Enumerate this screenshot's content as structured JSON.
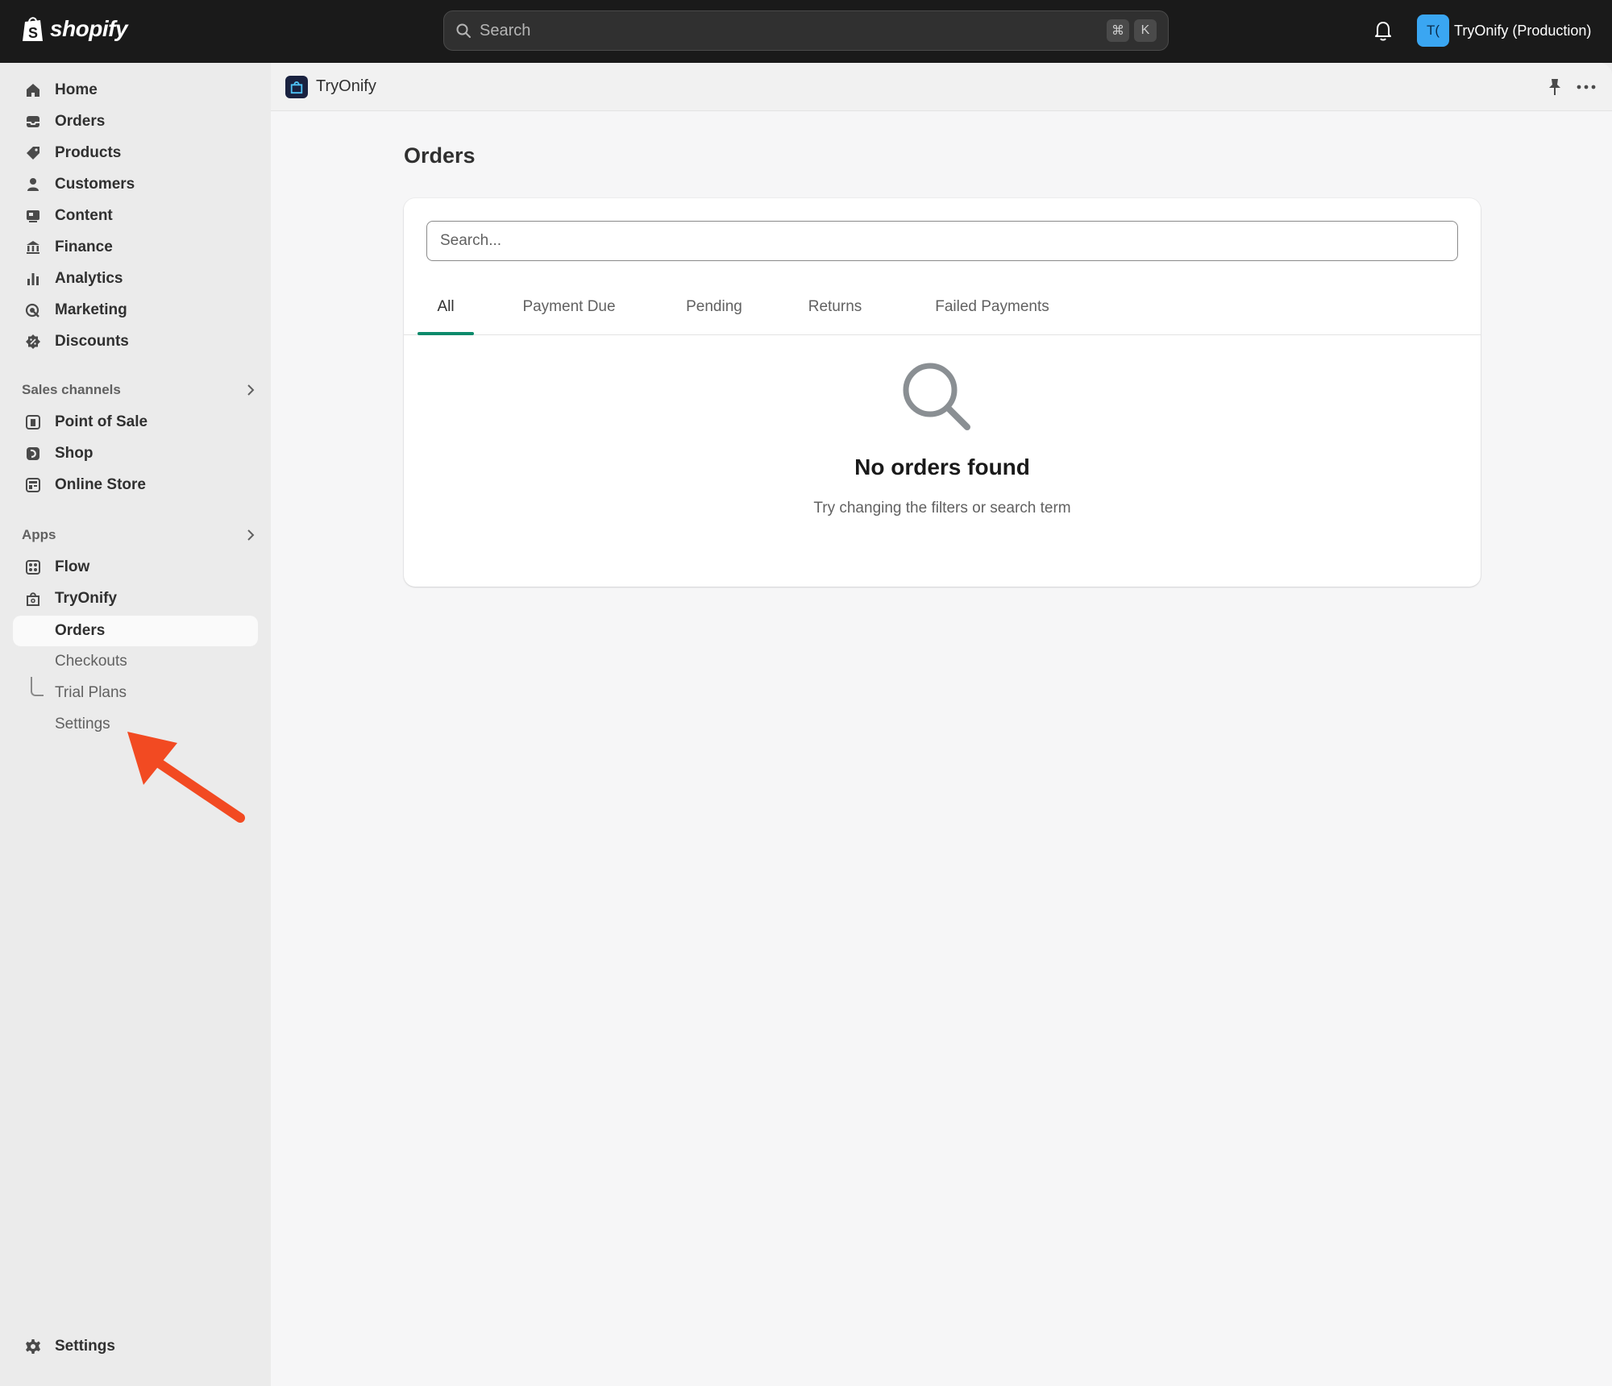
{
  "topbar": {
    "logo_text": "shopify",
    "search_placeholder": "Search",
    "shortcut_keys": [
      "⌘",
      "K"
    ],
    "account_initials": "T(",
    "account_name": "TryOnify (Production)"
  },
  "sidebar": {
    "main_items": [
      {
        "label": "Home",
        "icon": "home-icon"
      },
      {
        "label": "Orders",
        "icon": "orders-icon"
      },
      {
        "label": "Products",
        "icon": "tag-icon"
      },
      {
        "label": "Customers",
        "icon": "person-icon"
      },
      {
        "label": "Content",
        "icon": "content-icon"
      },
      {
        "label": "Finance",
        "icon": "bank-icon"
      },
      {
        "label": "Analytics",
        "icon": "bar-chart-icon"
      },
      {
        "label": "Marketing",
        "icon": "target-icon"
      },
      {
        "label": "Discounts",
        "icon": "discount-icon"
      }
    ],
    "sales_channels_label": "Sales channels",
    "sales_channels": [
      {
        "label": "Point of Sale",
        "icon": "pos-icon"
      },
      {
        "label": "Shop",
        "icon": "shop-icon"
      },
      {
        "label": "Online Store",
        "icon": "store-icon"
      }
    ],
    "apps_label": "Apps",
    "apps": [
      {
        "label": "Flow",
        "icon": "flow-icon"
      },
      {
        "label": "TryOnify",
        "icon": "bag-icon"
      }
    ],
    "app_subitems": [
      "Orders",
      "Checkouts",
      "Trial Plans",
      "Settings"
    ],
    "settings_label": "Settings"
  },
  "app_header": {
    "app_name": "TryOnify"
  },
  "page": {
    "title": "Orders",
    "search_placeholder": "Search...",
    "tabs": [
      "All",
      "Payment Due",
      "Pending",
      "Returns",
      "Failed Payments"
    ],
    "active_tab": "All",
    "empty_title": "No orders found",
    "empty_subtitle": "Try changing the filters or search term"
  },
  "colors": {
    "topbar_bg": "#1a1a1a",
    "accent_tab": "#0b8a6b",
    "avatar_bg": "#3aa6f2",
    "annotation_arrow": "#f24a22"
  }
}
